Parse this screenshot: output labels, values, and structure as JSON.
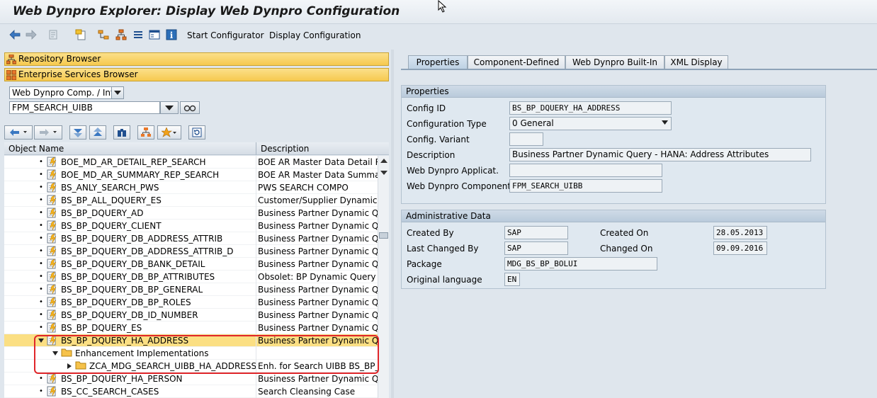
{
  "window": {
    "title": "Web Dynpro Explorer: Display Web Dynpro Configuration"
  },
  "toolbar": {
    "buttons": [
      {
        "label": "Start Configurator"
      },
      {
        "label": "Display Configuration"
      }
    ]
  },
  "left": {
    "repository_browser": "Repository Browser",
    "enterprise_services_browser": "Enterprise Services Browser",
    "object_type_select": "Web Dynpro Comp. / Intf.",
    "object_name_input": "FPM_SEARCH_UIBB",
    "tree": {
      "col_object_name": "Object Name",
      "col_description": "Description",
      "rows": [
        {
          "name": "BOE_MD_AR_DETAIL_REP_SEARCH",
          "desc": "BOE AR Master Data Detail Rep"
        },
        {
          "name": "BOE_MD_AR_SUMMARY_REP_SEARCH",
          "desc": "BOE AR Master Data Summary"
        },
        {
          "name": "BS_ANLY_SEARCH_PWS",
          "desc": "PWS SEARCH COMPO"
        },
        {
          "name": "BS_BP_ALL_DQUERY_ES",
          "desc": "Customer/Supplier Dynamic Qu"
        },
        {
          "name": "BS_BP_DQUERY_AD",
          "desc": "Business Partner Dynamic Quer"
        },
        {
          "name": "BS_BP_DQUERY_CLIENT",
          "desc": "Business Partner Dynamic Quer"
        },
        {
          "name": "BS_BP_DQUERY_DB_ADDRESS_ATTRIB",
          "desc": "Business Partner Dynamic Quer"
        },
        {
          "name": "BS_BP_DQUERY_DB_ADDRESS_ATTRIB_D",
          "desc": "Business Partner Dynamic Quer"
        },
        {
          "name": "BS_BP_DQUERY_DB_BANK_DETAIL",
          "desc": "Business Partner Dynamic Quer"
        },
        {
          "name": "BS_BP_DQUERY_DB_BP_ATTRIBUTES",
          "desc": "Obsolet: BP Dynamic Query - D"
        },
        {
          "name": "BS_BP_DQUERY_DB_BP_GENERAL",
          "desc": "Business Partner Dynamic Quer"
        },
        {
          "name": "BS_BP_DQUERY_DB_BP_ROLES",
          "desc": "Business Partner Dynamic Quer"
        },
        {
          "name": "BS_BP_DQUERY_DB_ID_NUMBER",
          "desc": "Business Partner Dynamic Quer"
        },
        {
          "name": "BS_BP_DQUERY_ES",
          "desc": "Business Partner Dynamic Quer"
        },
        {
          "name": "BS_BP_DQUERY_HA_ADDRESS",
          "desc": "Business Partner Dynamic Quer"
        },
        {
          "name": "Enhancement Implementations",
          "desc": ""
        },
        {
          "name": "ZCA_MDG_SEARCH_UIBB_HA_ADDRESS",
          "desc": "Enh. for Search UIBB BS_BP_D"
        },
        {
          "name": "BS_BP_DQUERY_HA_PERSON",
          "desc": "Business Partner Dynamic Quer"
        },
        {
          "name": "BS_CC_SEARCH_CASES",
          "desc": "Search Cleansing Case"
        }
      ]
    }
  },
  "tabs": [
    "Properties",
    "Component-Defined",
    "Web Dynpro Built-In",
    "XML Display"
  ],
  "properties": {
    "title": "Properties",
    "config_id_label": "Config ID",
    "config_id": "BS_BP_DQUERY_HA_ADDRESS",
    "config_type_label": "Configuration Type",
    "config_type": "0 General",
    "config_variant_label": "Config. Variant",
    "config_variant": "",
    "description_label": "Description",
    "description": "Business Partner Dynamic Query - HANA: Address Attributes",
    "wd_application_label": "Web Dynpro Applicat.",
    "wd_application": "",
    "wd_component_label": "Web Dynpro Component",
    "wd_component": "FPM_SEARCH_UIBB"
  },
  "admin": {
    "title": "Administrative Data",
    "created_by_label": "Created By",
    "created_by": "SAP",
    "created_on_label": "Created On",
    "created_on": "28.05.2013",
    "last_changed_by_label": "Last Changed By",
    "last_changed_by": "SAP",
    "changed_on_label": "Changed On",
    "changed_on": "09.09.2016",
    "package_label": "Package",
    "package": "MDG_BS_BP_BOLUI",
    "original_language_label": "Original language",
    "original_language": "EN"
  },
  "colors": {
    "selection": "#fbdf83",
    "highlight_box": "#e0262a",
    "browser_bar": "#f6c94f"
  }
}
